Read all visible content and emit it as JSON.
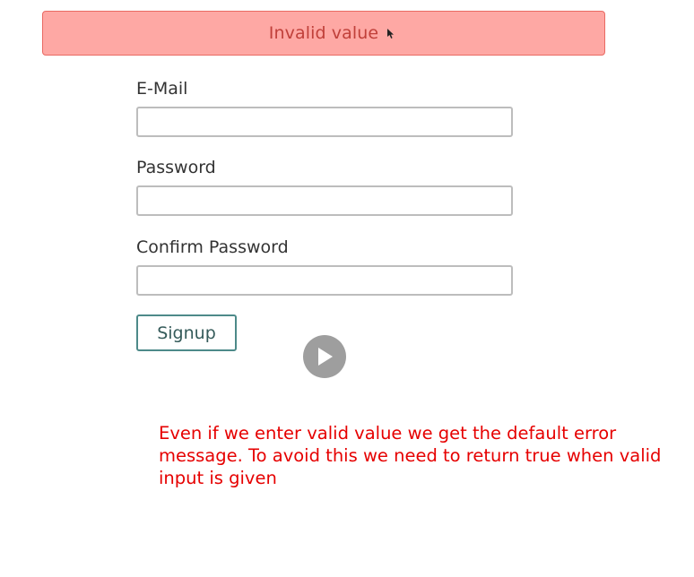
{
  "banner": {
    "text": "Invalid value",
    "background_color": "#fea8a4",
    "text_color": "#c0403a"
  },
  "form": {
    "email_label": "E-Mail",
    "email_value": "",
    "password_label": "Password",
    "password_value": "",
    "confirm_label": "Confirm Password",
    "confirm_value": "",
    "submit_label": "Signup"
  },
  "video_overlay": {
    "icon": "play-icon"
  },
  "note": {
    "text": "Even if we enter valid value we get the default error message. To avoid this we need to return true when valid input is given",
    "color": "#e60000"
  }
}
